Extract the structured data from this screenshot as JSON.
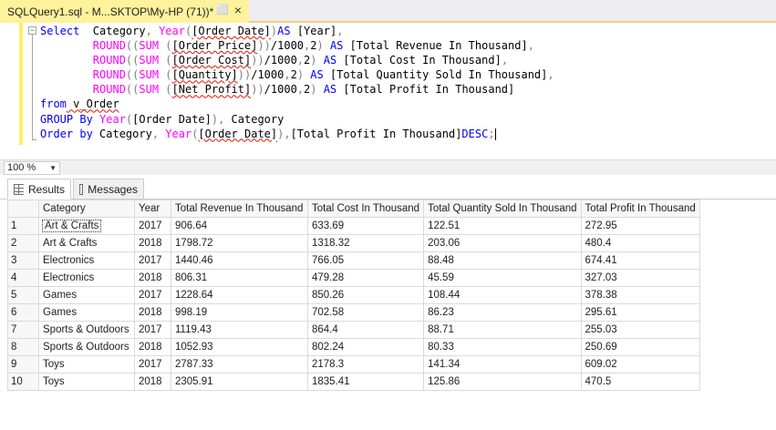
{
  "tab": {
    "title": "SQLQuery1.sql - M...SKTOP\\My-HP (71))*",
    "pin_glyph": "⬜",
    "close_glyph": "×"
  },
  "editor": {
    "lines": [
      [
        [
          "kw",
          "Select"
        ],
        [
          "tx",
          "  Category"
        ],
        [
          "gr",
          ", "
        ],
        [
          "fn",
          "Year"
        ],
        [
          "gr",
          "("
        ],
        [
          "tx sq",
          "[Order Date]"
        ],
        [
          "gr",
          ")"
        ],
        [
          "kw",
          "AS"
        ],
        [
          "tx",
          " [Year]"
        ],
        [
          "gr",
          ","
        ]
      ],
      [
        [
          "tx",
          "        "
        ],
        [
          "fn",
          "ROUND"
        ],
        [
          "gr",
          "(("
        ],
        [
          "fn",
          "SUM"
        ],
        [
          "gr",
          " ("
        ],
        [
          "tx sq",
          "[Order Price]"
        ],
        [
          "gr",
          "))"
        ],
        [
          "tx",
          "/1000"
        ],
        [
          "gr",
          ","
        ],
        [
          "tx",
          "2"
        ],
        [
          "gr",
          ")"
        ],
        [
          "tx",
          " "
        ],
        [
          "kw",
          "AS"
        ],
        [
          "tx",
          " [Total Revenue In Thousand]"
        ],
        [
          "gr",
          ","
        ]
      ],
      [
        [
          "tx",
          "        "
        ],
        [
          "fn",
          "ROUND"
        ],
        [
          "gr",
          "(("
        ],
        [
          "fn",
          "SUM"
        ],
        [
          "gr",
          " ("
        ],
        [
          "tx sq",
          "[Order Cost]"
        ],
        [
          "gr",
          "))"
        ],
        [
          "tx",
          "/1000"
        ],
        [
          "gr",
          ","
        ],
        [
          "tx",
          "2"
        ],
        [
          "gr",
          ")"
        ],
        [
          "tx",
          " "
        ],
        [
          "kw",
          "AS"
        ],
        [
          "tx",
          " [Total Cost In Thousand]"
        ],
        [
          "gr",
          ","
        ]
      ],
      [
        [
          "tx",
          "        "
        ],
        [
          "fn",
          "ROUND"
        ],
        [
          "gr",
          "(("
        ],
        [
          "fn",
          "SUM"
        ],
        [
          "gr",
          " ("
        ],
        [
          "tx sq",
          "[Quantity]"
        ],
        [
          "gr",
          "))"
        ],
        [
          "tx",
          "/1000"
        ],
        [
          "gr",
          ","
        ],
        [
          "tx",
          "2"
        ],
        [
          "gr",
          ")"
        ],
        [
          "tx",
          " "
        ],
        [
          "kw",
          "AS"
        ],
        [
          "tx",
          " [Total Quantity Sold In Thousand]"
        ],
        [
          "gr",
          ","
        ]
      ],
      [
        [
          "tx",
          "        "
        ],
        [
          "fn",
          "ROUND"
        ],
        [
          "gr",
          "(("
        ],
        [
          "fn",
          "SUM"
        ],
        [
          "gr",
          " ("
        ],
        [
          "tx sq",
          "[Net Profit]"
        ],
        [
          "gr",
          "))"
        ],
        [
          "tx",
          "/1000"
        ],
        [
          "gr",
          ","
        ],
        [
          "tx",
          "2"
        ],
        [
          "gr",
          ")"
        ],
        [
          "tx",
          " "
        ],
        [
          "kw",
          "AS"
        ],
        [
          "tx",
          " [Total Profit In Thousand]"
        ]
      ],
      [
        [
          "kw",
          "from"
        ],
        [
          "tx sq",
          " v_Order"
        ]
      ],
      [
        [
          "kw",
          "GROUP By"
        ],
        [
          "tx",
          " "
        ],
        [
          "fn",
          "Year"
        ],
        [
          "gr",
          "("
        ],
        [
          "tx",
          "[Order Date]"
        ],
        [
          "gr",
          "),"
        ],
        [
          "tx",
          " Category"
        ]
      ],
      [
        [
          "kw",
          "Order by"
        ],
        [
          "tx",
          " Category"
        ],
        [
          "gr",
          ", "
        ],
        [
          "fn",
          "Year"
        ],
        [
          "gr",
          "("
        ],
        [
          "tx sq",
          "[Order Date]"
        ],
        [
          "gr",
          "),"
        ],
        [
          "tx",
          "[Total Profit In Thousand]"
        ],
        [
          "kw",
          "DESC"
        ],
        [
          "gr",
          ";"
        ]
      ]
    ]
  },
  "zoom": {
    "value": "100 %",
    "arrow": "▼"
  },
  "result_tabs": {
    "results_label": "Results",
    "messages_label": "Messages"
  },
  "grid": {
    "columns": [
      "",
      "Category",
      "Year",
      "Total Revenue In Thousand",
      "Total Cost In Thousand",
      "Total Quantity Sold In Thousand",
      "Total Profit In Thousand"
    ],
    "rows": [
      [
        "1",
        "Art & Crafts",
        "2017",
        "906.64",
        "633.69",
        "122.51",
        "272.95"
      ],
      [
        "2",
        "Art & Crafts",
        "2018",
        "1798.72",
        "1318.32",
        "203.06",
        "480.4"
      ],
      [
        "3",
        "Electronics",
        "2017",
        "1440.46",
        "766.05",
        "88.48",
        "674.41"
      ],
      [
        "4",
        "Electronics",
        "2018",
        "806.31",
        "479.28",
        "45.59",
        "327.03"
      ],
      [
        "5",
        "Games",
        "2017",
        "1228.64",
        "850.26",
        "108.44",
        "378.38"
      ],
      [
        "6",
        "Games",
        "2018",
        "998.19",
        "702.58",
        "86.23",
        "295.61"
      ],
      [
        "7",
        "Sports & Outdoors",
        "2017",
        "1119.43",
        "864.4",
        "88.71",
        "255.03"
      ],
      [
        "8",
        "Sports & Outdoors",
        "2018",
        "1052.93",
        "802.24",
        "80.33",
        "250.69"
      ],
      [
        "9",
        "Toys",
        "2017",
        "2787.33",
        "2178.3",
        "141.34",
        "609.02"
      ],
      [
        "10",
        "Toys",
        "2018",
        "2305.91",
        "1835.41",
        "125.86",
        "470.5"
      ]
    ]
  }
}
